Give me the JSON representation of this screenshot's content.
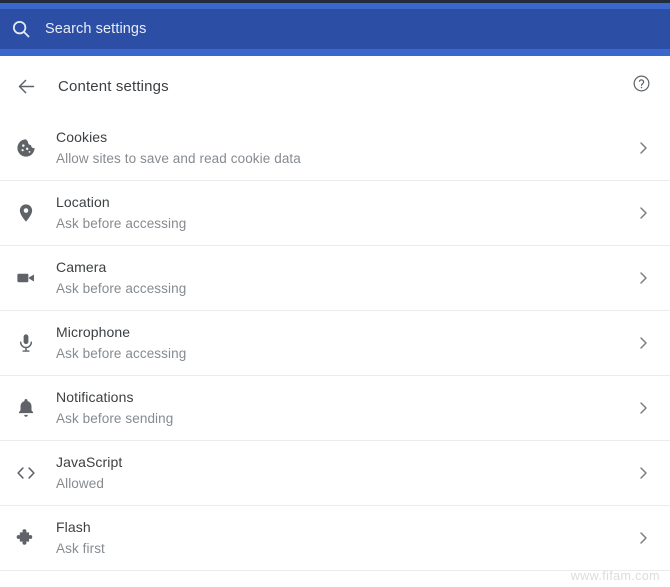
{
  "window": {
    "title": "Content settings"
  },
  "theme": {
    "search_bar_bg": "#2c4fa5",
    "search_bar_accent": "#3a68cd",
    "top_strip": "#232c3e",
    "page_bg": "#ffffff",
    "title_color": "#3c4043",
    "subtitle_color": "#868b90",
    "icon_color": "#5f6368",
    "divider_color": "#ebebeb"
  },
  "search": {
    "icon": "search-icon",
    "placeholder": "Search settings",
    "value": ""
  },
  "header": {
    "back_icon": "arrow-left-icon",
    "title": "Content settings",
    "help_icon": "help-circle-icon"
  },
  "settings": {
    "rows": [
      {
        "icon": "cookie-icon",
        "title": "Cookies",
        "subtitle": "Allow sites to save and read cookie data",
        "chevron": "chevron-right-icon"
      },
      {
        "icon": "location-pin-icon",
        "title": "Location",
        "subtitle": "Ask before accessing",
        "chevron": "chevron-right-icon"
      },
      {
        "icon": "camera-icon",
        "title": "Camera",
        "subtitle": "Ask before accessing",
        "chevron": "chevron-right-icon"
      },
      {
        "icon": "microphone-icon",
        "title": "Microphone",
        "subtitle": "Ask before accessing",
        "chevron": "chevron-right-icon"
      },
      {
        "icon": "bell-icon",
        "title": "Notifications",
        "subtitle": "Ask before sending",
        "chevron": "chevron-right-icon"
      },
      {
        "icon": "code-brackets-icon",
        "title": "JavaScript",
        "subtitle": "Allowed",
        "chevron": "chevron-right-icon"
      },
      {
        "icon": "puzzle-piece-icon",
        "title": "Flash",
        "subtitle": "Ask first",
        "chevron": "chevron-right-icon"
      }
    ]
  },
  "watermark": {
    "text": "www.fifam.com"
  }
}
